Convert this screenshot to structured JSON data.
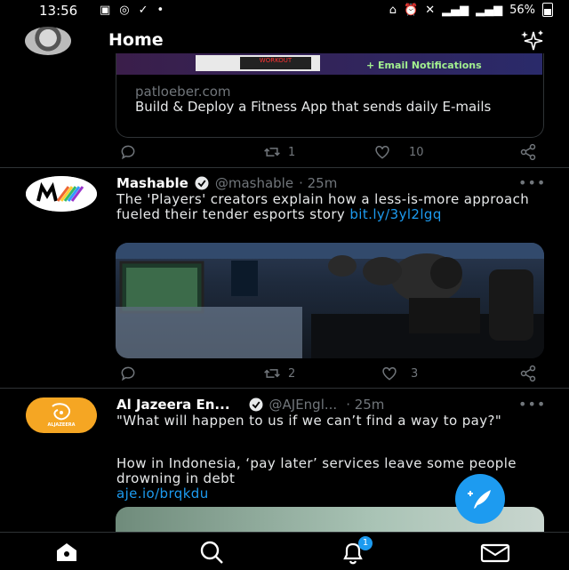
{
  "status": {
    "time": "13:56",
    "battery": "56%"
  },
  "header": {
    "title": "Home"
  },
  "card1": {
    "banner_text": "+ Email Notifications",
    "thumb_text": "WORKOUT",
    "domain": "patloeber.com",
    "title": "Build & Deploy a Fitness App that sends daily E-mails",
    "retweets": "1",
    "likes": "10"
  },
  "tweet_mashable": {
    "name": "Mashable",
    "handle": "@mashable",
    "time": "· 25m",
    "text": "The 'Players' creators explain how a less-is-more approach fueled their tender esports story",
    "link": "bit.ly/3yl2lgq",
    "retweets": "2",
    "likes": "3"
  },
  "tweet_aljazeera": {
    "name": "Al Jazeera En...",
    "handle": "@AJEngl...",
    "time": "· 25m",
    "avatar_text": "ALJAZEERA",
    "quote": "\"What will happen to us if we can’t find a way to pay?\"",
    "text": "How in Indonesia, ‘pay later’ services leave some people drowning in debt",
    "link": "aje.io/brqkdu"
  },
  "nav": {
    "notifications_count": "1"
  }
}
